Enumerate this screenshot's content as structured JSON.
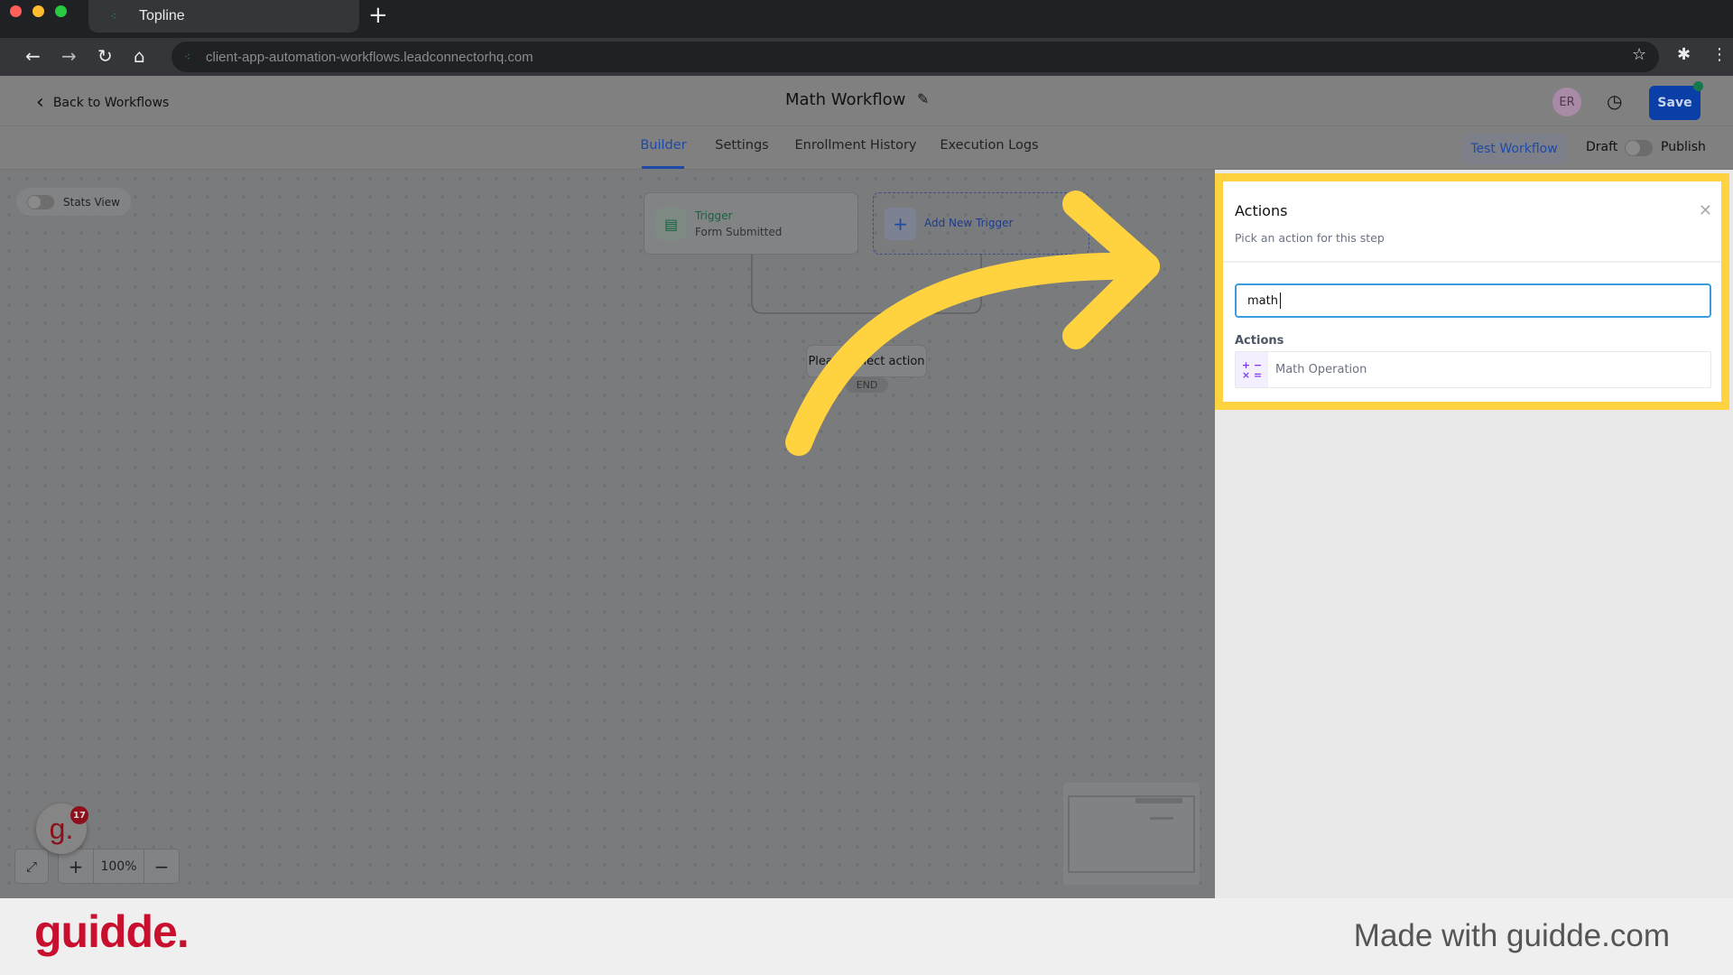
{
  "browser": {
    "tab_title": "Topline",
    "url": "client-app-automation-workflows.leadconnectorhq.com",
    "new_tab": "+"
  },
  "header": {
    "back_label": "Back to Workflows",
    "title": "Math Workflow",
    "avatar_initials": "ER",
    "save_label": "Save"
  },
  "tabs": [
    {
      "label": "Builder",
      "active": true
    },
    {
      "label": "Settings"
    },
    {
      "label": "Enrollment History"
    },
    {
      "label": "Execution Logs"
    }
  ],
  "toolbar": {
    "test_label": "Test Workflow",
    "draft_label": "Draft",
    "publish_label": "Publish",
    "published": false
  },
  "canvas": {
    "stats_view_label": "Stats View",
    "trigger_title": "Trigger",
    "trigger_subtitle": "Form Submitted",
    "add_trigger_label": "Add New Trigger",
    "placeholder_label": "Please select action",
    "end_label": "END",
    "zoom_level": "100%",
    "zoom_in": "+",
    "zoom_out": "−",
    "notification_count": "17",
    "guidde_avatar": "g."
  },
  "panel": {
    "title": "Actions",
    "subtitle": "Pick an action for this step",
    "search_value": "math",
    "section_label": "Actions",
    "items": [
      {
        "label": "Math Operation",
        "icon": "math-operators-icon"
      }
    ]
  },
  "footer": {
    "logo": "guidde.",
    "made_with": "Made with guidde.com"
  },
  "colors": {
    "accent": "#1e4fd8",
    "highlight": "#ffd23f",
    "save": "#0b3fa8",
    "brand": "#c8102e"
  }
}
